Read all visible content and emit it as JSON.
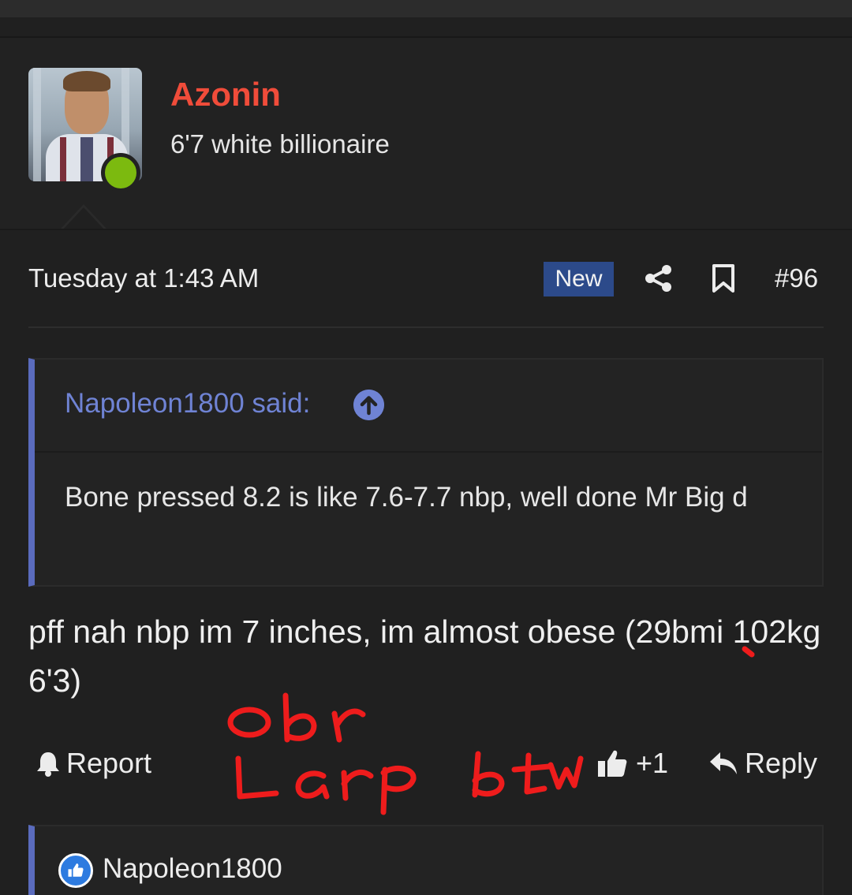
{
  "user": {
    "name": "Azonin",
    "title": "6'7 white billionaire",
    "status_color": "#7cba0f",
    "name_color": "#f04c3a"
  },
  "post": {
    "date": "Tuesday at 1:43 AM",
    "badge": "New",
    "number": "#96",
    "body": "pff nah nbp im 7 inches, im almost obese (29bmi 102kg 6'3)"
  },
  "quote": {
    "author": "Napoleon1800 said:",
    "text": "Bone pressed 8.2 is like 7.6-7.7 nbp, well done Mr Big d"
  },
  "actions": {
    "report": "Report",
    "like_count": "+1",
    "reply": "Reply"
  },
  "annotation": {
    "line1": "obr",
    "line2": "Larp btw",
    "color": "#ee1c1c"
  },
  "reactions": {
    "user": "Napoleon1800",
    "icon": "thumbs-up-icon"
  },
  "colors": {
    "background": "#202020",
    "quote_accent": "#5a6bbd",
    "badge_bg": "#2c4a8a"
  }
}
